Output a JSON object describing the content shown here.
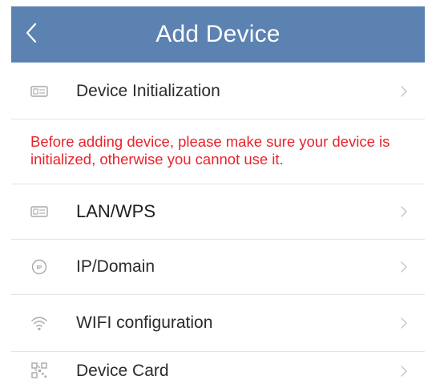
{
  "header": {
    "title": "Add Device",
    "back_icon": "chevron-left-icon",
    "background_color": "#5b82b1"
  },
  "items": [
    {
      "label": "Device Initialization",
      "icon": "device-card-icon"
    },
    {
      "label": "LAN/WPS",
      "icon": "device-card-icon"
    },
    {
      "label": "IP/Domain",
      "icon": "ip-pin-icon"
    },
    {
      "label": "WIFI configuration",
      "icon": "wifi-icon"
    },
    {
      "label": "Device Card",
      "icon": "qr-code-icon"
    }
  ],
  "warning": {
    "text": "Before adding device, please make sure your device is initialized, otherwise you cannot use it.",
    "color": "#e8232b"
  },
  "chevron_icon": "chevron-right-icon"
}
